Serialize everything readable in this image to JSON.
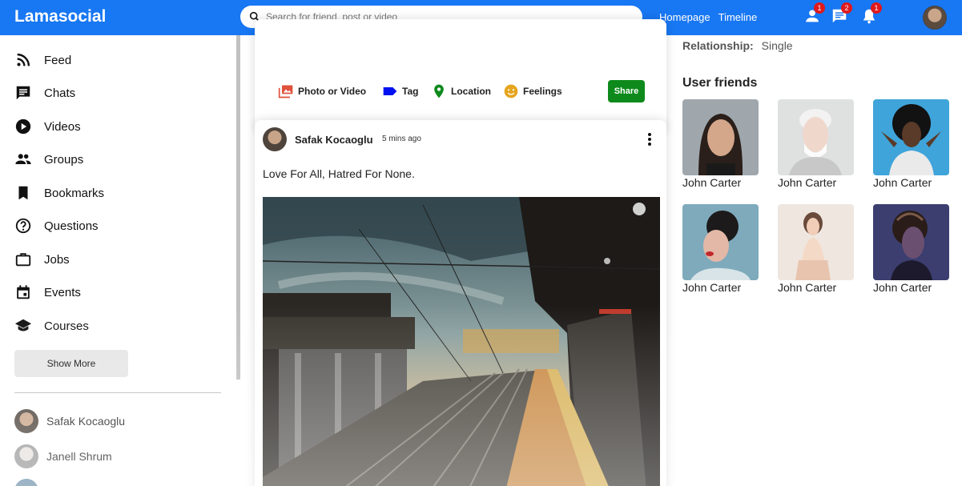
{
  "app": {
    "logo": "Lamasocial"
  },
  "topbar": {
    "search_placeholder": "Search for friend, post or video",
    "links": [
      "Homepage",
      "Timeline"
    ],
    "badges": {
      "person": "1",
      "chat": "2",
      "notifications": "1"
    },
    "accent": "#1877f2"
  },
  "sidebar": {
    "items": [
      {
        "label": "Feed",
        "icon": "rss-feed-icon"
      },
      {
        "label": "Chats",
        "icon": "chat-icon"
      },
      {
        "label": "Videos",
        "icon": "play-circle-icon"
      },
      {
        "label": "Groups",
        "icon": "group-icon"
      },
      {
        "label": "Bookmarks",
        "icon": "bookmark-icon"
      },
      {
        "label": "Questions",
        "icon": "help-outline-icon"
      },
      {
        "label": "Jobs",
        "icon": "work-outline-icon"
      },
      {
        "label": "Events",
        "icon": "event-icon"
      },
      {
        "label": "Courses",
        "icon": "school-icon"
      }
    ],
    "show_more": "Show More",
    "friends": [
      {
        "name": "Safak Kocaoglu"
      },
      {
        "name": "Janell Shrum"
      }
    ]
  },
  "share": {
    "options": [
      {
        "label": "Photo or Video",
        "color": "#e0513b"
      },
      {
        "label": "Tag",
        "color": "#0010f0"
      },
      {
        "label": "Location",
        "color": "#0d8a1b"
      },
      {
        "label": "Feelings",
        "color": "#e5a51e"
      }
    ],
    "button": "Share",
    "button_color": "#0d8a1b"
  },
  "post": {
    "username": "Safak Kocaoglu",
    "time": "5 mins ago",
    "text": "Love For All, Hatred For None."
  },
  "rightbar": {
    "relationship_key": "Relationship:",
    "relationship_value": "Single",
    "title": "User friends",
    "friends": [
      {
        "name": "John Carter"
      },
      {
        "name": "John Carter"
      },
      {
        "name": "John Carter"
      },
      {
        "name": "John Carter"
      },
      {
        "name": "John Carter"
      },
      {
        "name": "John Carter"
      }
    ]
  }
}
